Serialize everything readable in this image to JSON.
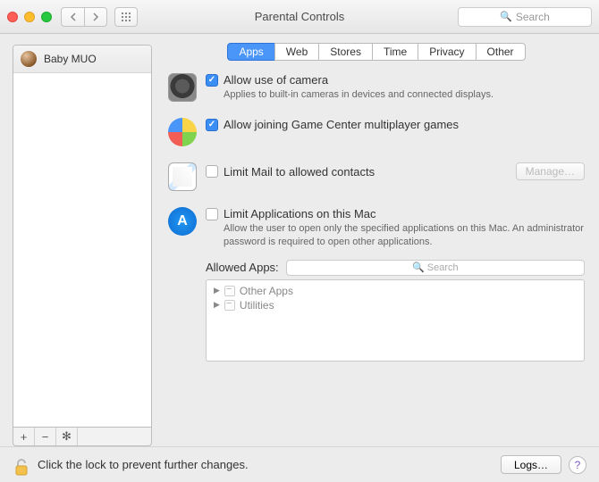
{
  "window": {
    "title": "Parental Controls"
  },
  "toolbar": {
    "search_placeholder": "Search"
  },
  "sidebar": {
    "users": [
      {
        "name": "Baby MUO"
      }
    ],
    "tools": {
      "add": "+",
      "remove": "−",
      "action": "✻"
    }
  },
  "tabs": [
    {
      "label": "Apps",
      "active": true
    },
    {
      "label": "Web"
    },
    {
      "label": "Stores"
    },
    {
      "label": "Time"
    },
    {
      "label": "Privacy"
    },
    {
      "label": "Other"
    }
  ],
  "settings": {
    "camera": {
      "label": "Allow use of camera",
      "desc": "Applies to built-in cameras in devices and connected displays.",
      "checked": true
    },
    "gamecenter": {
      "label": "Allow joining Game Center multiplayer games",
      "checked": true
    },
    "mail": {
      "label": "Limit Mail to allowed contacts",
      "checked": false,
      "manage": "Manage…"
    },
    "apps": {
      "label": "Limit Applications on this Mac",
      "desc": "Allow the user to open only the specified applications on this Mac. An administrator password is required to open other applications.",
      "checked": false,
      "allowed_label": "Allowed Apps:",
      "search_placeholder": "Search",
      "list": [
        {
          "name": "Other Apps"
        },
        {
          "name": "Utilities"
        }
      ]
    }
  },
  "footer": {
    "lock_text": "Click the lock to prevent further changes.",
    "logs": "Logs…",
    "help": "?"
  }
}
